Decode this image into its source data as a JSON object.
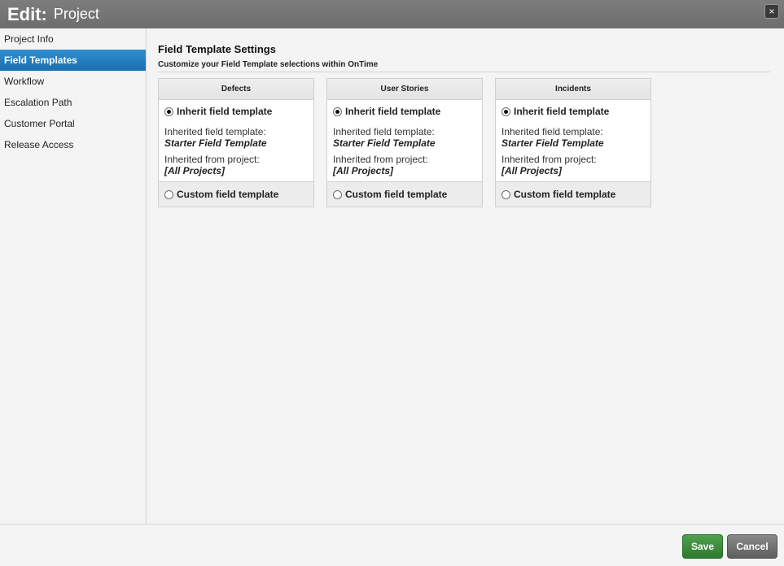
{
  "window": {
    "title_prefix": "Edit:",
    "title_object": "Project",
    "close_symbol": "×"
  },
  "sidebar": {
    "items": [
      {
        "label": "Project Info",
        "active": false
      },
      {
        "label": "Field Templates",
        "active": true
      },
      {
        "label": "Workflow",
        "active": false
      },
      {
        "label": "Escalation Path",
        "active": false
      },
      {
        "label": "Customer Portal",
        "active": false
      },
      {
        "label": "Release Access",
        "active": false
      }
    ]
  },
  "main": {
    "heading": "Field Template Settings",
    "subtitle": "Customize your Field Template selections within OnTime",
    "cards": [
      {
        "title": "Defects",
        "inherit_label": "Inherit field template",
        "inherited_template_label": "Inherited field template:",
        "inherited_template_value": "Starter Field Template",
        "inherited_project_label": "Inherited from project:",
        "inherited_project_value": "[All Projects]",
        "custom_label": "Custom field template",
        "selected": "inherit"
      },
      {
        "title": "User Stories",
        "inherit_label": "Inherit field template",
        "inherited_template_label": "Inherited field template:",
        "inherited_template_value": "Starter Field Template",
        "inherited_project_label": "Inherited from project:",
        "inherited_project_value": "[All Projects]",
        "custom_label": "Custom field template",
        "selected": "inherit"
      },
      {
        "title": "Incidents",
        "inherit_label": "Inherit field template",
        "inherited_template_label": "Inherited field template:",
        "inherited_template_value": "Starter Field Template",
        "inherited_project_label": "Inherited from project:",
        "inherited_project_value": "[All Projects]",
        "custom_label": "Custom field template",
        "selected": "inherit"
      }
    ]
  },
  "footer": {
    "save_label": "Save",
    "cancel_label": "Cancel"
  },
  "colors": {
    "titlebar": "#757575",
    "active_nav": "#1f7cc0",
    "save_button": "#3a8a3a",
    "cancel_button": "#6e6e6e"
  }
}
